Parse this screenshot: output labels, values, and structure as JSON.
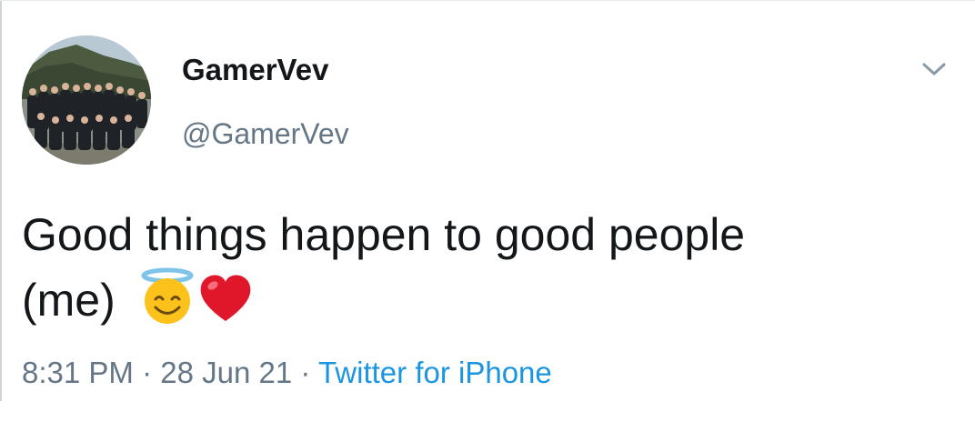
{
  "tweet": {
    "display_name": "GamerVev",
    "handle": "@GamerVev",
    "text_line1": "Good things happen to good people",
    "text_line2": "(me)",
    "emojis": [
      "smiling-face-with-halo-icon",
      "red-heart-icon"
    ],
    "time": "8:31 PM",
    "separator": "·",
    "date": "28 Jun 21",
    "source": "Twitter for iPhone"
  },
  "colors": {
    "text_primary": "#14171a",
    "text_secondary": "#657786",
    "link": "#1b95e0",
    "heart": "#e0162b",
    "halo": "#7fc4e8",
    "face": "#fcc21b"
  },
  "icons": {
    "menu": "chevron-down-icon"
  }
}
